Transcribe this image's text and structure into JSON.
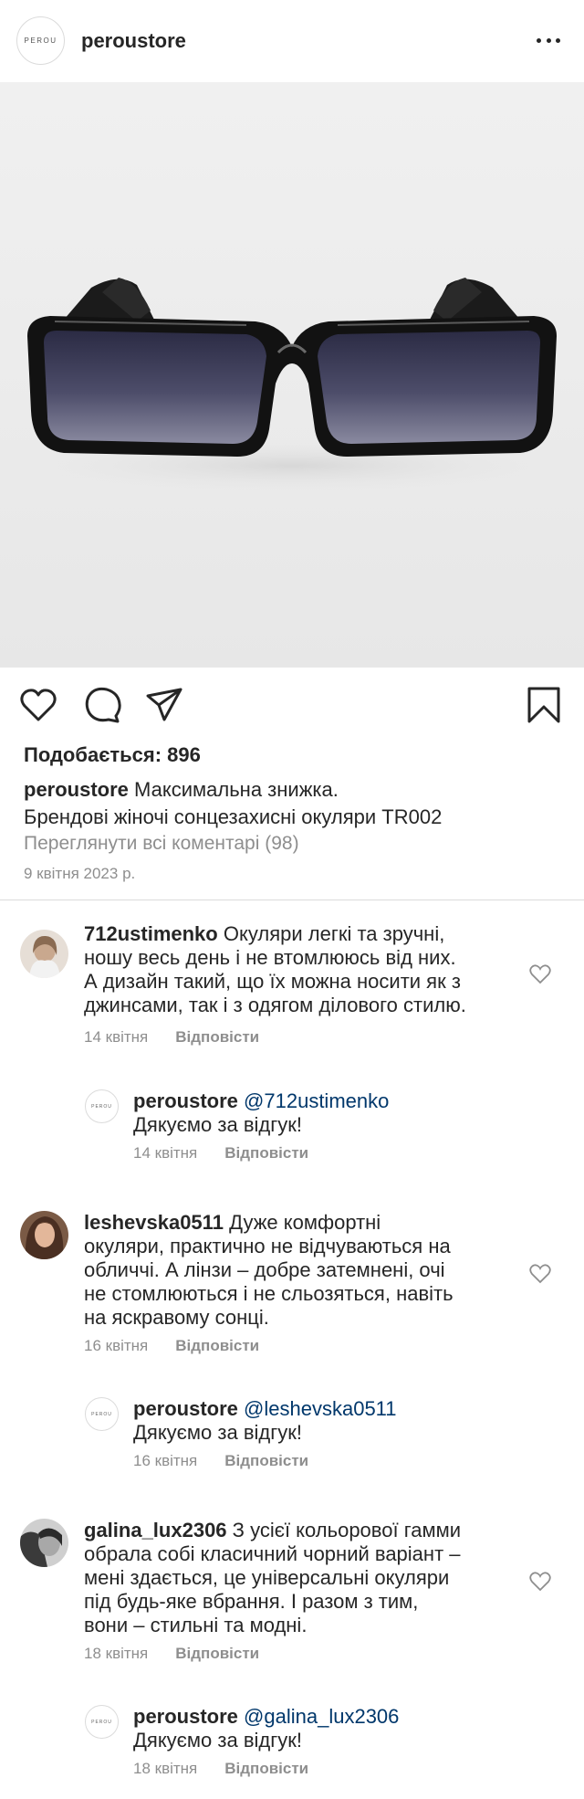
{
  "header": {
    "logo_text": "PEROU",
    "username": "peroustore"
  },
  "post": {
    "likes_label": "Подобається: 896",
    "caption_user": "peroustore",
    "caption_line1": "Максимальна знижка.",
    "caption_line2": "Брендові жіночі сонцезахисні окуляри TR002",
    "view_all": "Переглянути всі коментарі (98)",
    "date": "9 квітня 2023 р."
  },
  "comments": [
    {
      "user": "712ustimenko",
      "lines": [
        "Окуляри легкі та зручні,",
        "ношу весь день і не втомлююсь від них.",
        "А дизайн такий, що їх можна носити як з",
        "джинсами, так і з одягом ділового стилю."
      ],
      "time": "14 квітня",
      "reply_label": "Відповісти",
      "reply": {
        "user": "peroustore",
        "mention": "@712ustimenko",
        "text": "Дякуємо за відгук!",
        "time": "14 квітня",
        "reply_label": "Відповісти"
      }
    },
    {
      "user": "leshevska0511",
      "lines": [
        "Дуже комфортні",
        "окуляри, практично не відчуваються на",
        "обличчі. А лінзи – добре затемнені, очі",
        "не стомлюються і не сльозяться, навіть",
        "на яскравому сонці."
      ],
      "time": "16 квітня",
      "reply_label": "Відповісти",
      "reply": {
        "user": "peroustore",
        "mention": "@leshevska0511",
        "text": "Дякуємо за відгук!",
        "time": "16 квітня",
        "reply_label": "Відповісти"
      }
    },
    {
      "user": "galina_lux2306",
      "lines": [
        " З усієї кольорової гамми",
        "обрала собі класичний чорний варіант –",
        "мені здається, це універсальні окуляри",
        "під будь-яке вбрання. І разом з тим,",
        "вони – стильні та модні."
      ],
      "time": "18 квітня",
      "reply_label": "Відповісти",
      "reply": {
        "user": "peroustore",
        "mention": "@galina_lux2306",
        "text": "Дякуємо за відгук!",
        "time": "18 квітня",
        "reply_label": "Відповісти"
      }
    }
  ],
  "reply_logo_text": "PEROU",
  "icons": {
    "more": "more-horizontal-icon",
    "like": "heart-icon",
    "comment": "comment-bubble-icon",
    "share": "paper-plane-icon",
    "save": "bookmark-icon"
  }
}
